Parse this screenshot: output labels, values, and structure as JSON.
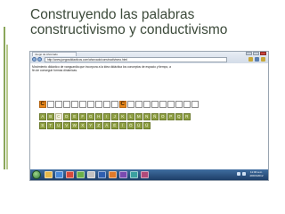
{
  "slide": {
    "title_line1": "Construyendo las palabras",
    "title_line2": "constructivismo y conductivismo"
  },
  "browser": {
    "tab_title": "Juego de Ahorcado",
    "address": "http://www.juegosdidacticos.com/ahorcado/constructivismo.html"
  },
  "game": {
    "instructions": "Movimiento didáctico de vanguardia que incorpora a la idea didáctica los conceptos de espacio y tiempo, a fin de conseguir formas dinámicas.",
    "word_cells": [
      "C",
      "",
      "",
      "",
      "",
      "",
      "",
      "",
      "",
      "",
      "C",
      "",
      "",
      "",
      "",
      "",
      "",
      "",
      "",
      ""
    ],
    "keyboard_row1": [
      "A",
      "B",
      "C",
      "D",
      "E",
      "F",
      "G",
      "H",
      "I",
      "J",
      "K",
      "L",
      "M",
      "N",
      "Ñ",
      "O",
      "P",
      "Q",
      "R"
    ],
    "keyboard_row2": [
      "S",
      "T",
      "U",
      "V",
      "W",
      "X",
      "Y",
      "Z",
      "Á",
      "É",
      "Í",
      "Ó",
      "Ú",
      "Ü"
    ],
    "used_letters": [
      "C"
    ]
  },
  "taskbar": {
    "time": "11:00 a.m.",
    "date": "28/03/2012"
  }
}
